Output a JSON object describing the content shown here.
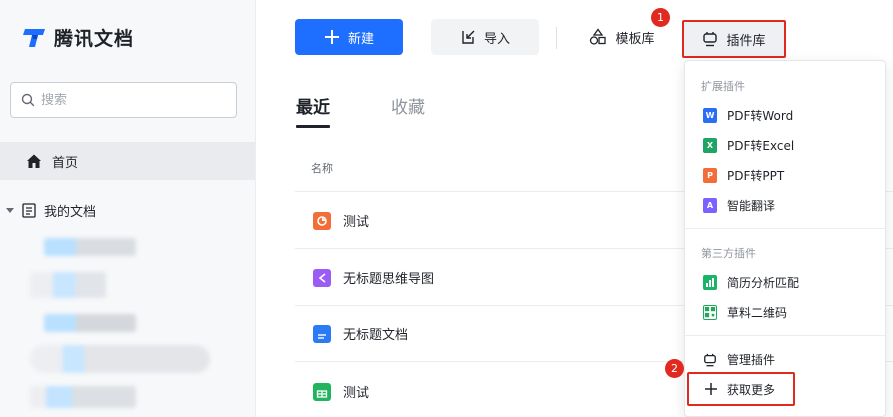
{
  "app": {
    "name": "腾讯文档"
  },
  "sidebar": {
    "search_placeholder": "搜索",
    "home_label": "首页",
    "my_docs_label": "我的文档"
  },
  "toolbar": {
    "new_label": "新建",
    "import_label": "导入",
    "template_label": "模板库",
    "plugins_label": "插件库"
  },
  "tabs": {
    "recent": "最近",
    "favorites": "收藏"
  },
  "list": {
    "column_name": "名称",
    "rows": [
      {
        "name": "测试",
        "icon": "slides-icon",
        "color": "#f26d38"
      },
      {
        "name": "无标题思维导图",
        "icon": "mindmap-icon",
        "color": "#9b5cf6"
      },
      {
        "name": "无标题文档",
        "icon": "doc-icon",
        "color": "#2b7bf6"
      },
      {
        "name": "测试",
        "icon": "sheet-icon",
        "color": "#22b35e"
      }
    ]
  },
  "plugin_menu": {
    "section_extensions": "扩展插件",
    "extensions": [
      {
        "label": "PDF转Word",
        "icon": "word-icon",
        "color": "#2b6ef6"
      },
      {
        "label": "PDF转Excel",
        "icon": "excel-icon",
        "color": "#1fa463"
      },
      {
        "label": "PDF转PPT",
        "icon": "ppt-icon",
        "color": "#f26d38"
      },
      {
        "label": "智能翻译",
        "icon": "translate-icon",
        "color": "#7b61ff"
      }
    ],
    "section_thirdparty": "第三方插件",
    "thirdparty": [
      {
        "label": "简历分析匹配",
        "icon": "resume-icon",
        "color": "#18b566"
      },
      {
        "label": "草料二维码",
        "icon": "qrcode-icon",
        "color": "#22a85a"
      }
    ],
    "manage_label": "管理插件",
    "get_more_label": "获取更多"
  },
  "badges": {
    "first": "1",
    "second": "2"
  },
  "colors": {
    "accent": "#1e6fff",
    "highlight": "#e0291f"
  }
}
